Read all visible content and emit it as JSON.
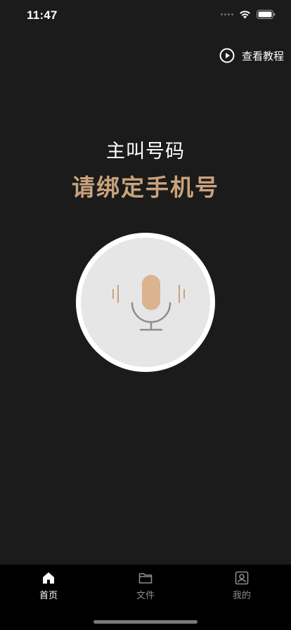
{
  "status_bar": {
    "time": "11:47"
  },
  "tutorial": {
    "label": "查看教程",
    "icon": "play-circle-icon"
  },
  "caller": {
    "label": "主叫号码",
    "value": "请绑定手机号"
  },
  "mic": {
    "icon": "microphone-icon"
  },
  "tab_bar": {
    "tabs": [
      {
        "label": "首页",
        "icon": "home-icon",
        "active": true
      },
      {
        "label": "文件",
        "icon": "folder-icon",
        "active": false
      },
      {
        "label": "我的",
        "icon": "profile-icon",
        "active": false
      }
    ]
  },
  "colors": {
    "background": "#1b1b1b",
    "accent": "#c9a27c",
    "tab_bar": "#000000",
    "tab_inactive": "#8c8c8c"
  }
}
